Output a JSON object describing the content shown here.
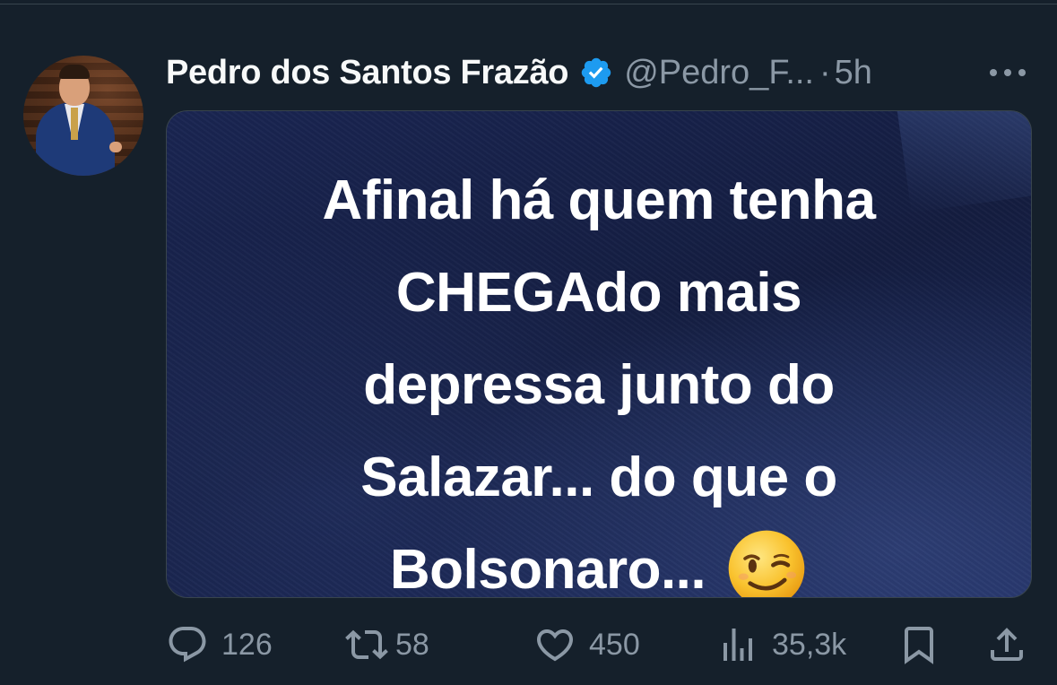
{
  "tweet": {
    "author": {
      "display_name": "Pedro dos Santos Frazão",
      "handle": "@Pedro_F...",
      "verified": true,
      "verified_color": "#1d9bf0"
    },
    "separator": "·",
    "time": "5h",
    "media": {
      "lines": [
        "Afinal há quem tenha",
        "CHEGAdo mais",
        "depressa junto do",
        "Salazar... do que o",
        "Bolsonaro..."
      ],
      "emoji": "winking-face"
    },
    "actions": {
      "replies": "126",
      "retweets": "58",
      "likes": "450",
      "views": "35,3k"
    }
  },
  "colors": {
    "background": "#15202b",
    "secondary_text": "#8b98a5",
    "primary_text": "#f7f9f9",
    "border": "#38444d"
  },
  "icons": [
    "verified-badge-icon",
    "more-icon",
    "reply-icon",
    "retweet-icon",
    "like-icon",
    "views-icon",
    "bookmark-icon",
    "share-icon"
  ]
}
